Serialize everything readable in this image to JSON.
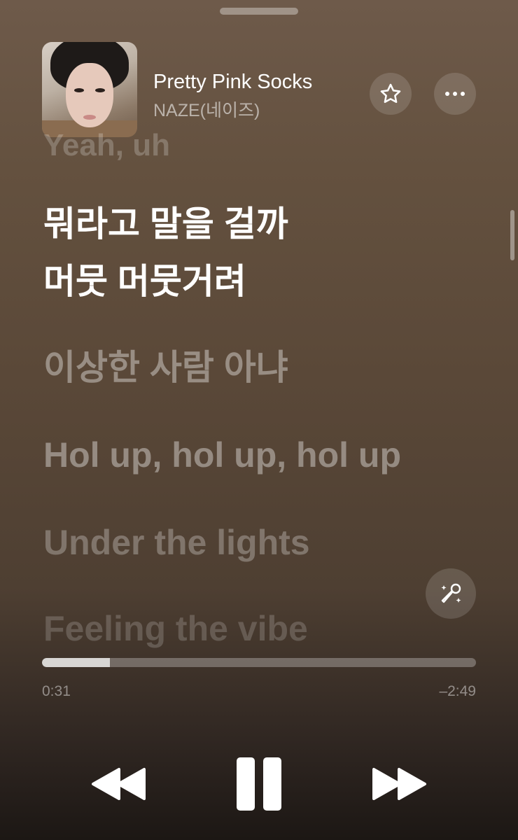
{
  "track": {
    "title": "Pretty Pink Socks",
    "artist": "NAZE(네이즈)",
    "artwork_icon": "album-art"
  },
  "actions": {
    "favorite_icon": "star-icon",
    "more_icon": "ellipsis-icon",
    "sing_icon": "microphone-sparkle-icon"
  },
  "lyrics": {
    "previous": "Yeah, uh",
    "current_line_1": "뭐라고 말을 걸까",
    "current_line_2": "머뭇 머뭇거려",
    "upcoming": [
      "이상한 사람 아냐",
      "Hol up, hol up, hol up",
      "Under the lights",
      "Feeling the vibe"
    ]
  },
  "playback": {
    "elapsed": "0:31",
    "remaining": "–2:49",
    "progress_fraction": 0.156
  },
  "controls": {
    "rewind_icon": "rewind-icon",
    "pause_icon": "pause-icon",
    "forward_icon": "fast-forward-icon"
  },
  "colors": {
    "background_top": "#6e5a4a",
    "background_bottom": "#1c1714",
    "active_lyric": "#ffffff"
  }
}
